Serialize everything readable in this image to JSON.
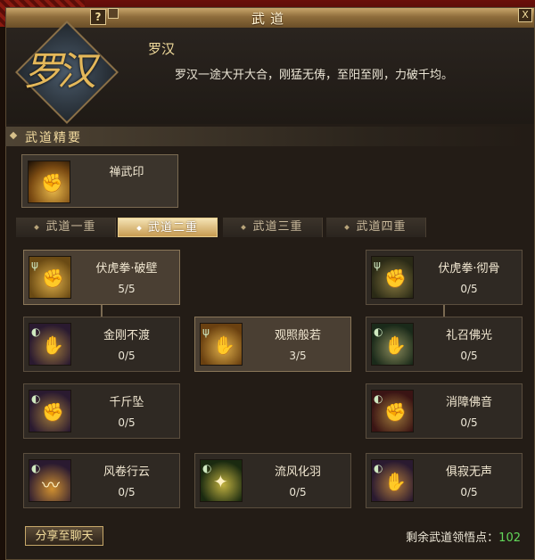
{
  "window": {
    "title": "武道",
    "help_label": "?",
    "close_label": "X"
  },
  "class_info": {
    "emblem_text": "罗汉",
    "name": "罗汉",
    "description": "罗汉一途大开大合，刚猛无俦，至阳至刚，力破千均。"
  },
  "section_title": "武道精要",
  "core_skill": {
    "name": "禅武印"
  },
  "tabs": [
    {
      "label": "武道一重",
      "active": false
    },
    {
      "label": "武道二重",
      "active": true
    },
    {
      "label": "武道三重",
      "active": false
    },
    {
      "label": "武道四重",
      "active": false
    }
  ],
  "skills": [
    {
      "name": "伏虎拳·破壁",
      "points": "5/5",
      "icon": "fist-icon",
      "color": "#c8a038"
    },
    {
      "name": "伏虎拳·彻骨",
      "points": "0/5",
      "icon": "fist-icon",
      "color": "#6a6a3a"
    },
    {
      "name": "金刚不渡",
      "points": "0/5",
      "icon": "gauntlet-icon",
      "color": "#4a3a5a"
    },
    {
      "name": "观照般若",
      "points": "3/5",
      "icon": "gauntlet-icon",
      "color": "#c09040"
    },
    {
      "name": "礼召佛光",
      "points": "0/5",
      "icon": "palm-icon",
      "color": "#3a5a3a"
    },
    {
      "name": "千斤坠",
      "points": "0/5",
      "icon": "fist-icon",
      "color": "#4a3a5a"
    },
    {
      "name": "消障佛音",
      "points": "0/5",
      "icon": "fist-icon",
      "color": "#5a2a2a"
    },
    {
      "name": "风卷行云",
      "points": "0/5",
      "icon": "wind-icon",
      "color": "#4a3a5a"
    },
    {
      "name": "流风化羽",
      "points": "0/5",
      "icon": "feather-icon",
      "color": "#3a5a2a"
    },
    {
      "name": "俱寂无声",
      "points": "0/5",
      "icon": "hand-icon",
      "color": "#4a3a5a"
    }
  ],
  "share_button": "分享至聊天",
  "remaining": {
    "label": "剩余武道领悟点：",
    "value": "102"
  },
  "colors": {
    "accent": "#f2dc9c",
    "points_green": "#62d85a"
  }
}
